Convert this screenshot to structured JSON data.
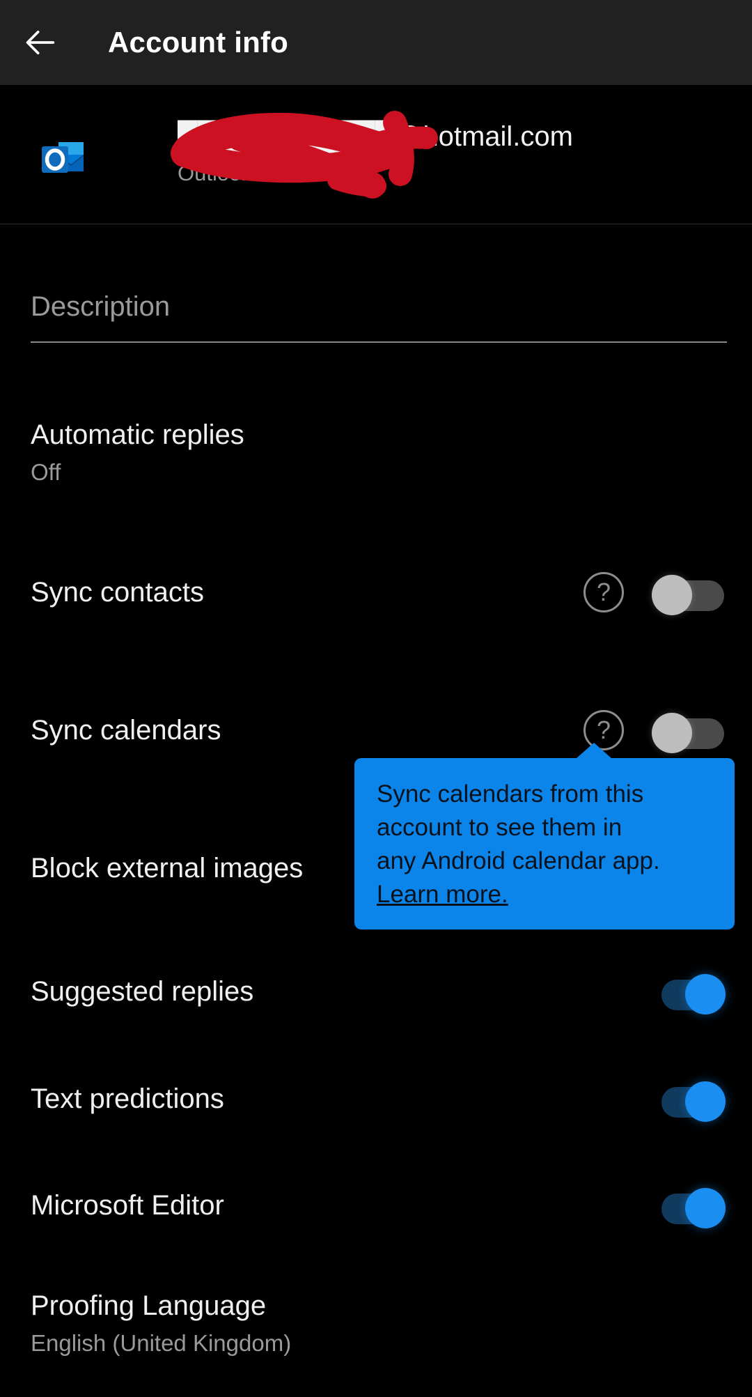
{
  "appbar": {
    "back_icon": "arrow-left-icon",
    "title": "Account info"
  },
  "account": {
    "provider_icon": "outlook-icon",
    "email": "███████████@hotmail.com",
    "email_visible_suffix": "@hotmail.com",
    "type": "Outlook",
    "redacted": true,
    "redaction_color": "#cc1122"
  },
  "description": {
    "value": "",
    "placeholder": "Description"
  },
  "settings": [
    {
      "name": "automatic-replies",
      "title": "Automatic replies",
      "subtitle": "Off",
      "control": "none"
    },
    {
      "name": "sync-contacts",
      "title": "Sync contacts",
      "subtitle": "",
      "control": "toggle",
      "toggle_state": "off",
      "help": "help-icon"
    },
    {
      "name": "sync-calendars",
      "title": "Sync calendars",
      "subtitle": "",
      "control": "toggle",
      "toggle_state": "off",
      "help": "help-icon"
    },
    {
      "name": "block-external-images",
      "title": "Block external images",
      "subtitle": "",
      "control": "none"
    },
    {
      "name": "suggested-replies",
      "title": "Suggested replies",
      "subtitle": "",
      "control": "toggle",
      "toggle_state": "on"
    },
    {
      "name": "text-predictions",
      "title": "Text predictions",
      "subtitle": "",
      "control": "toggle",
      "toggle_state": "on"
    },
    {
      "name": "microsoft-editor",
      "title": "Microsoft Editor",
      "subtitle": "",
      "control": "toggle",
      "toggle_state": "on"
    },
    {
      "name": "proofing-language",
      "title": "Proofing Language",
      "subtitle": "English (United Kingdom)",
      "control": "none"
    }
  ],
  "tooltip": {
    "line1": "Sync calendars from this",
    "line2": "account to see them in",
    "line3": "any Android calendar app.",
    "link": "Learn more.",
    "background": "#0c85eb",
    "text_color": "#07121d",
    "anchored_to": "sync-calendars-help-icon"
  },
  "help_glyph": "?",
  "colors": {
    "page_background": "#000000",
    "appbar_background": "#212121",
    "primary_text": "#f0f0f0",
    "secondary_text": "#9a9a9a",
    "toggle_on": "#1b8ef2",
    "toggle_off": "#bdbdbd",
    "accent": "#0c85eb"
  }
}
